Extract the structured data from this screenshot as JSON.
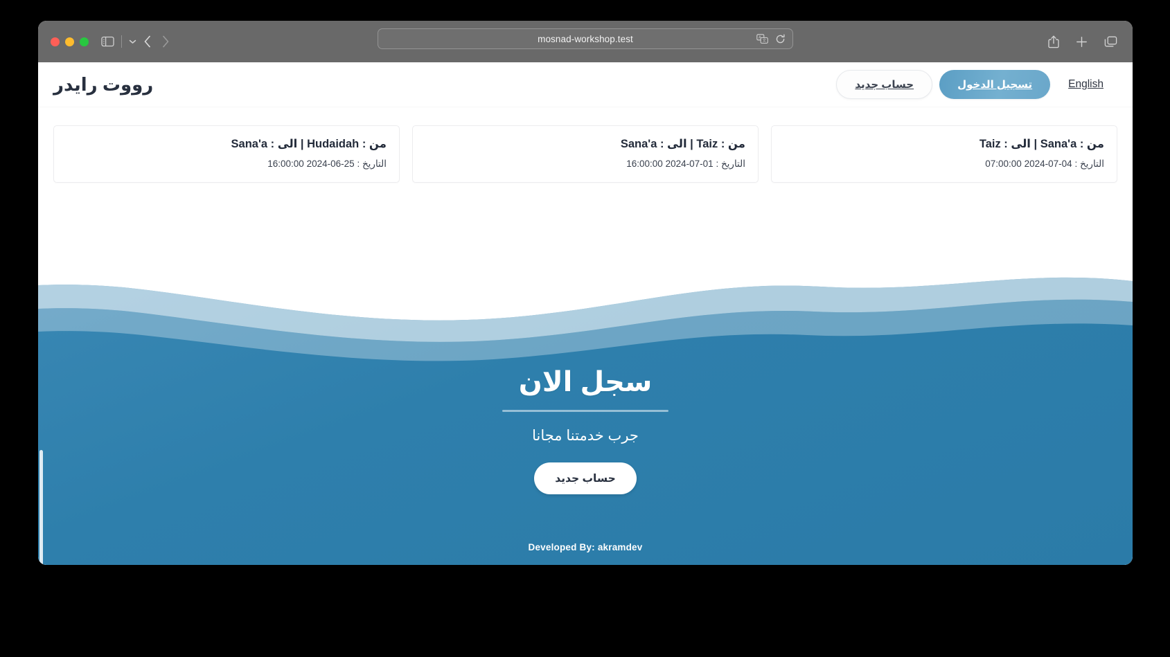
{
  "browser": {
    "url": "mosnad-workshop.test",
    "icons": {
      "sidebar": "sidebar-icon",
      "sidebar_chevron": "chevron-down-icon",
      "back": "back-arrow-icon",
      "forward": "forward-arrow-icon",
      "translate": "translate-icon",
      "reload": "reload-icon",
      "share": "share-icon",
      "new_tab": "plus-icon",
      "tab_overview": "tab-overview-icon"
    },
    "traffic_lights": {
      "close": "#ff5f57",
      "minimize": "#febc2e",
      "maximize": "#28c840"
    }
  },
  "site": {
    "brand": "رووت رايدر",
    "nav": {
      "register_label": "حساب جديد",
      "login_label": "تسجيل الدخول",
      "language_label": "English"
    },
    "trips": [
      {
        "route": "من : Sana'a | الى : Taiz",
        "date": "التاريخ : 04-07-2024 07:00:00"
      },
      {
        "route": "من : Taiz | الى : Sana'a",
        "date": "التاريخ : 01-07-2024 16:00:00"
      },
      {
        "route": "من : Hudaidah | الى : Sana'a",
        "date": "التاريخ : 25-06-2024 16:00:00"
      }
    ],
    "hero": {
      "title": "سجل الان",
      "subtitle": "جرب خدمتنا مجانا",
      "cta_label": "حساب جديد"
    },
    "footer": {
      "credit": "Developed By: akramdev"
    },
    "colors": {
      "accent_blue": "#2e7fac",
      "login_button": "#6aa7ca",
      "brand_text": "#28303f",
      "chrome_gray": "#696969"
    }
  }
}
